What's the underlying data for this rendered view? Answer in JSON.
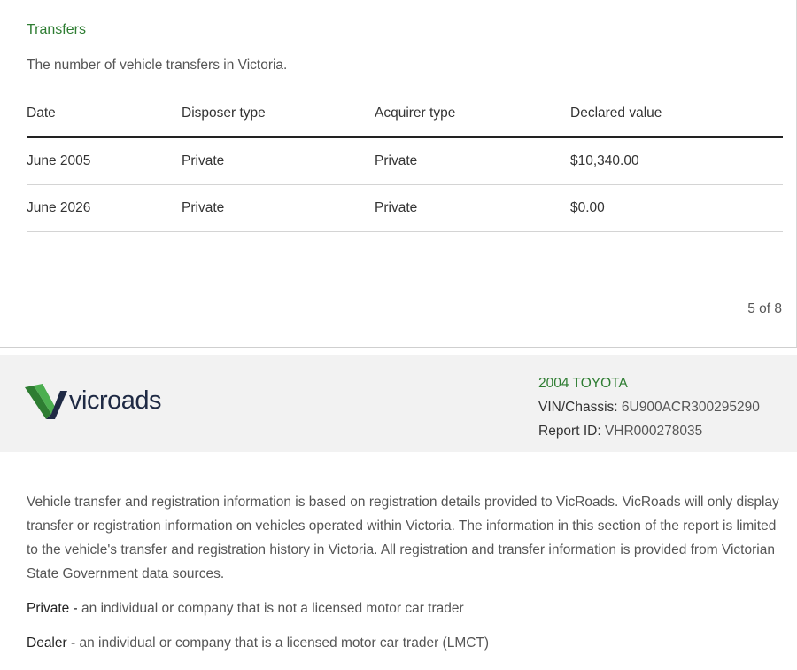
{
  "transfers": {
    "title": "Transfers",
    "description": "The number of vehicle transfers in Victoria.",
    "columns": [
      "Date",
      "Disposer type",
      "Acquirer type",
      "Declared value"
    ],
    "rows": [
      {
        "date": "June 2005",
        "disposer": "Private",
        "acquirer": "Private",
        "value": "$10,340.00"
      },
      {
        "date": "June 2026",
        "disposer": "Private",
        "acquirer": "Private",
        "value": "$0.00"
      }
    ]
  },
  "page": {
    "number": "5 of 8"
  },
  "header": {
    "logo_text": "vicroads",
    "vehicle": "2004 TOYOTA",
    "vin_label": "VIN/Chassis:",
    "vin_value": "6U900ACR300295290",
    "report_label": "Report ID:",
    "report_value": "VHR000278035"
  },
  "info": {
    "paragraph": "Vehicle transfer and registration information is based on registration details provided to VicRoads. VicRoads will only display transfer or registration information on vehicles operated within Victoria. The information in this section of the report is limited to the vehicle's transfer and registration history in Victoria. All registration and transfer information is provided from Victorian State Government data sources.",
    "private_term": "Private -",
    "private_def": "an individual or company that is not a licensed motor car trader",
    "dealer_term": "Dealer -",
    "dealer_def": "an individual or company that is a licensed motor car trader (LMCT)"
  },
  "colors": {
    "accent": "#2e7d32",
    "header_bg": "#f2f2f2",
    "logo_dark": "#1f2a44"
  },
  "icons": {
    "logo": "vicroads-logo-icon"
  }
}
